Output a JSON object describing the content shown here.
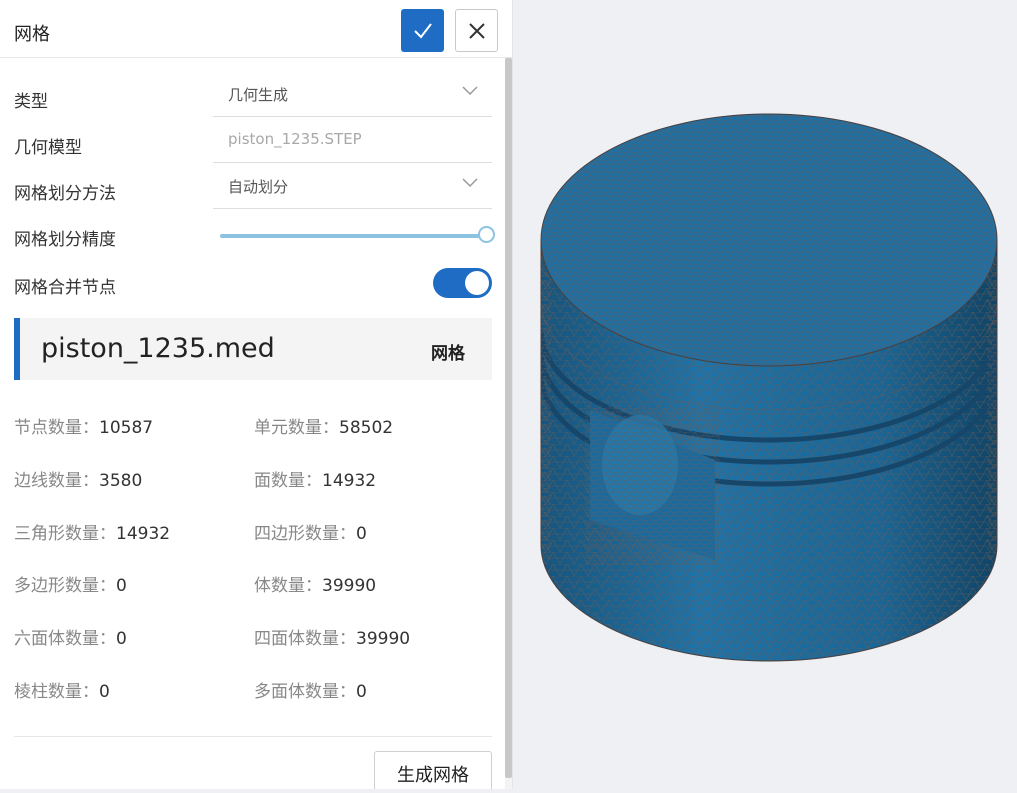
{
  "panel": {
    "title": "网格",
    "confirm_icon": "check-icon",
    "close_icon": "close-icon"
  },
  "form": {
    "type": {
      "label": "类型",
      "value": "几何生成"
    },
    "geometry": {
      "label": "几何模型",
      "placeholder": "piston_1235.STEP"
    },
    "method": {
      "label": "网格划分方法",
      "value": "自动划分"
    },
    "precision": {
      "label": "网格划分精度",
      "level": 1.0
    },
    "merge_nodes": {
      "label": "网格合并节点",
      "enabled": true
    }
  },
  "mesh_file": {
    "name": "piston_1235.med",
    "tag": "网格"
  },
  "stats": [
    {
      "label": "节点数量：",
      "value": "10587"
    },
    {
      "label": "单元数量：",
      "value": "58502"
    },
    {
      "label": "边线数量：",
      "value": "3580"
    },
    {
      "label": "面数量：",
      "value": "14932"
    },
    {
      "label": "三角形数量：",
      "value": "14932"
    },
    {
      "label": "四边形数量：",
      "value": "0"
    },
    {
      "label": "多边形数量：",
      "value": "0"
    },
    {
      "label": "体数量：",
      "value": "39990"
    },
    {
      "label": "六面体数量：",
      "value": "0"
    },
    {
      "label": "四面体数量：",
      "value": "39990"
    },
    {
      "label": "棱柱数量：",
      "value": "0"
    },
    {
      "label": "多面体数量：",
      "value": "0"
    }
  ],
  "actions": {
    "generate_label": "生成网格"
  },
  "colors": {
    "accent": "#1f6cc4",
    "slider": "#8cc3e0",
    "mesh_surface": "#1e6fa3",
    "mesh_lines": "#6b5a55"
  }
}
